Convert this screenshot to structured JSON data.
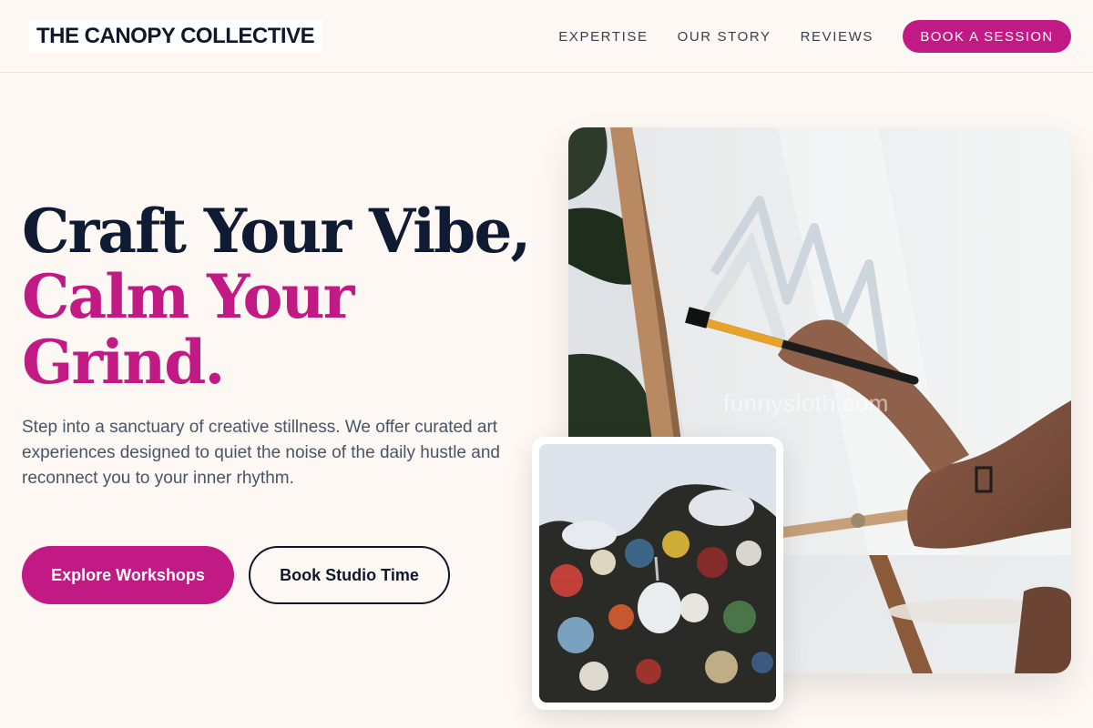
{
  "header": {
    "logo": "THE CANOPY COLLECTIVE",
    "nav": [
      {
        "label": "EXPERTISE"
      },
      {
        "label": "OUR STORY"
      },
      {
        "label": "REVIEWS"
      }
    ],
    "cta_label": "BOOK A SESSION"
  },
  "hero": {
    "headline_line1": "Craft Your Vibe,",
    "headline_line2": "Calm Your",
    "headline_line3": "Grind.",
    "lead": "Step into a sanctuary of creative stillness. We offer curated art experiences designed to quiet the noise of the daily hustle and reconnect you to your inner rhythm.",
    "primary_button": "Explore Workshops",
    "secondary_button": "Book Studio Time"
  },
  "images": {
    "main_watermark": "funnysloth.com"
  },
  "colors": {
    "accent": "#c21a84",
    "heading_dark": "#0f1a33",
    "background": "#fdf8f3",
    "body_text": "#475569"
  },
  "icons": []
}
